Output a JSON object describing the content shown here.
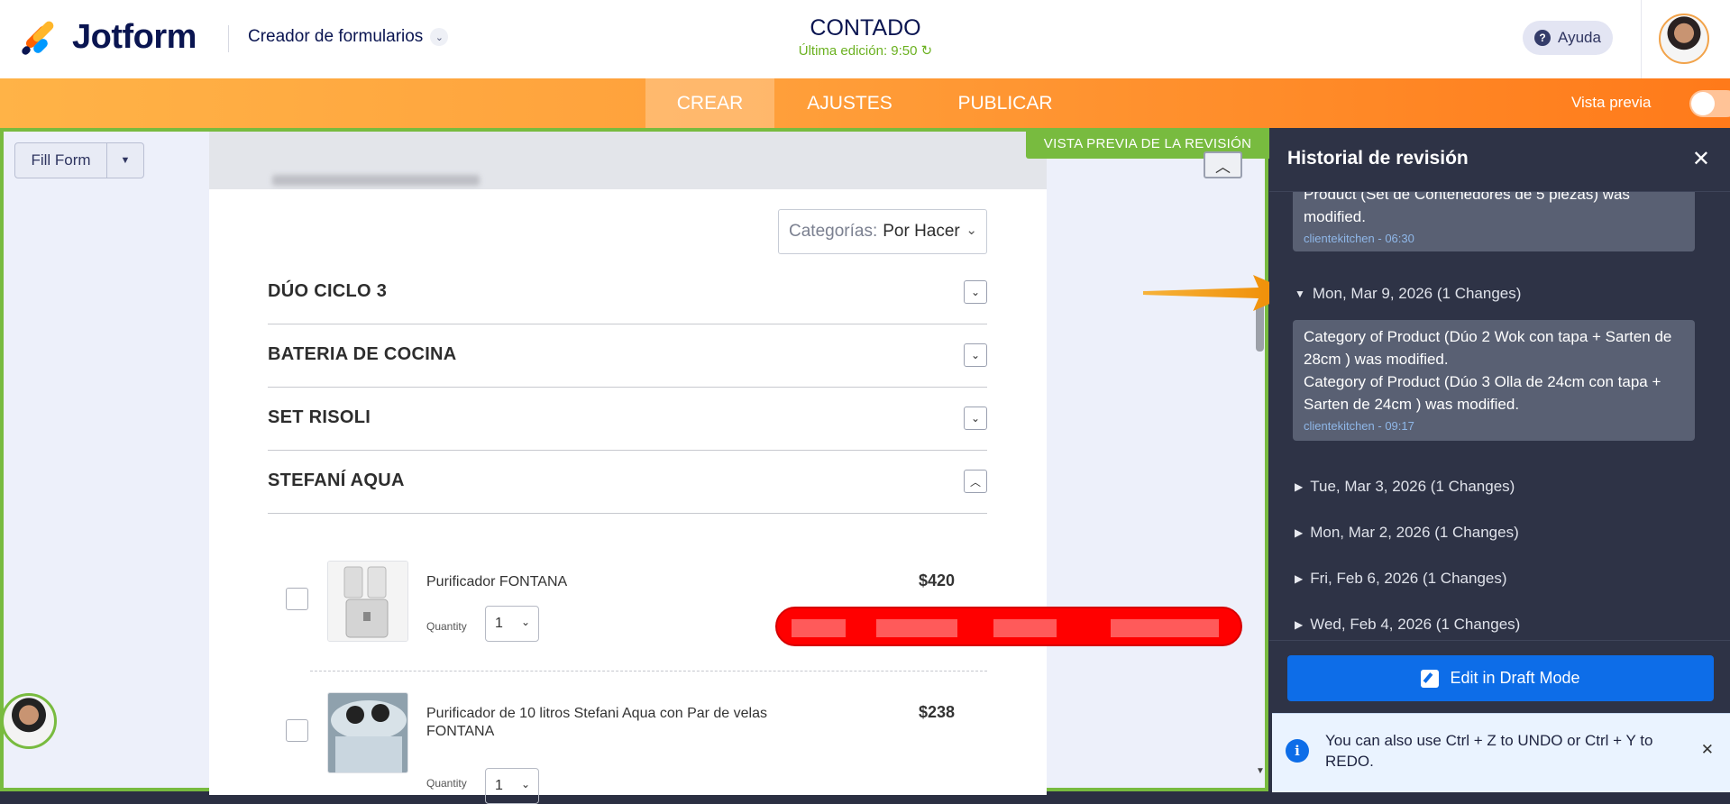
{
  "header": {
    "brand": "Jotform",
    "builder_label": "Creador de formularios",
    "form_title": "CONTADO",
    "last_edit": "Última edición: 9:50 ↻",
    "help_label": "Ayuda"
  },
  "nav": {
    "tabs": [
      "CREAR",
      "AJUSTES",
      "PUBLICAR"
    ],
    "active_tab": "CREAR",
    "preview_label": "Vista previa",
    "preview_on": false
  },
  "canvas": {
    "fill_form_label": "Fill Form",
    "revision_tag": "VISTA PREVIA DE LA REVISIÓN",
    "category_key": "Categorías:",
    "category_value": "Por Hacer",
    "sections": [
      "DÚO CICLO 3",
      "BATERIA DE COCINA",
      "SET RISOLI",
      "STEFANÍ AQUA"
    ],
    "products": [
      {
        "name": "Purificador FONTANA",
        "price": "$420",
        "quantity_label": "Quantity",
        "quantity": "1"
      },
      {
        "name": "Purificador de 10 litros Stefani Aqua con Par de velas FONTANA",
        "price": "$238",
        "quantity_label": "Quantity",
        "quantity": "1"
      }
    ]
  },
  "panel": {
    "title": "Historial de revisión",
    "top_entry": {
      "text": "Product (Set de Contenedores de 5 piezas) was modified.",
      "meta": "clientekitchen - 06:30"
    },
    "expanded": {
      "date": "Mon, Mar 9, 2026 (1 Changes)",
      "text1": "Category of Product (Dúo 2 Wok con tapa + Sarten de 28cm ) was modified.",
      "text2": "Category of Product (Dúo 3 Olla de 24cm con tapa + Sarten de 24cm ) was modified.",
      "meta": "clientekitchen - 09:17"
    },
    "dates": [
      "Tue, Mar 3, 2026 (1 Changes)",
      "Mon, Mar 2, 2026 (1 Changes)",
      "Fri, Feb 6, 2026 (1 Changes)",
      "Wed, Feb 4, 2026 (1 Changes)"
    ],
    "draft_button": "Edit in Draft Mode",
    "tip": "You can also use Ctrl + Z to UNDO or Ctrl + Y to REDO."
  },
  "colors": {
    "brand_navy": "#0a1551",
    "nav_orange": "#ff9f3a",
    "revision_green": "#78bb3f",
    "panel_bg": "#2e3346",
    "draft_blue": "#0d6de8"
  }
}
